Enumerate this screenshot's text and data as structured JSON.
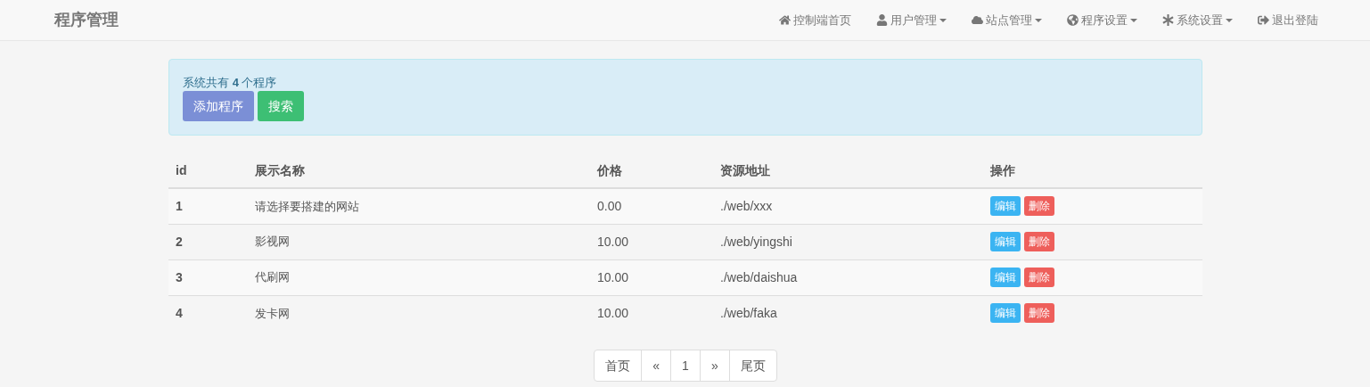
{
  "navbar": {
    "brand": "程序管理",
    "items": [
      {
        "label": "控制端首页",
        "dropdown": false
      },
      {
        "label": "用户管理",
        "dropdown": true
      },
      {
        "label": "站点管理",
        "dropdown": true
      },
      {
        "label": "程序设置",
        "dropdown": true
      },
      {
        "label": "系统设置",
        "dropdown": true
      },
      {
        "label": "退出登陆",
        "dropdown": false
      }
    ]
  },
  "info_panel": {
    "summary": "系统共有 **4** 个程序",
    "buttons": [
      {
        "label": "添加程序",
        "kind": "primary"
      },
      {
        "label": "搜索",
        "kind": "success"
      }
    ]
  },
  "table": {
    "columns": [
      "id",
      "展示名称",
      "价格",
      "资源地址",
      "操作"
    ],
    "rows": [
      {
        "id": "1",
        "name": "请选择要搭建的网站",
        "price": "0.00",
        "path": "./web/xxx",
        "actions": [
          "编辑",
          "删除"
        ]
      },
      {
        "id": "2",
        "name": "影视网",
        "price": "10.00",
        "path": "./web/yingshi",
        "actions": [
          "编辑",
          "删除"
        ]
      },
      {
        "id": "3",
        "name": "代刷网",
        "price": "10.00",
        "path": "./web/daishua",
        "actions": [
          "编辑",
          "删除"
        ]
      },
      {
        "id": "4",
        "name": "发卡网",
        "price": "10.00",
        "path": "./web/faka",
        "actions": [
          "编辑",
          "删除"
        ]
      }
    ]
  },
  "pagination": [
    "首页",
    "«",
    "1",
    "»",
    "尾页"
  ]
}
